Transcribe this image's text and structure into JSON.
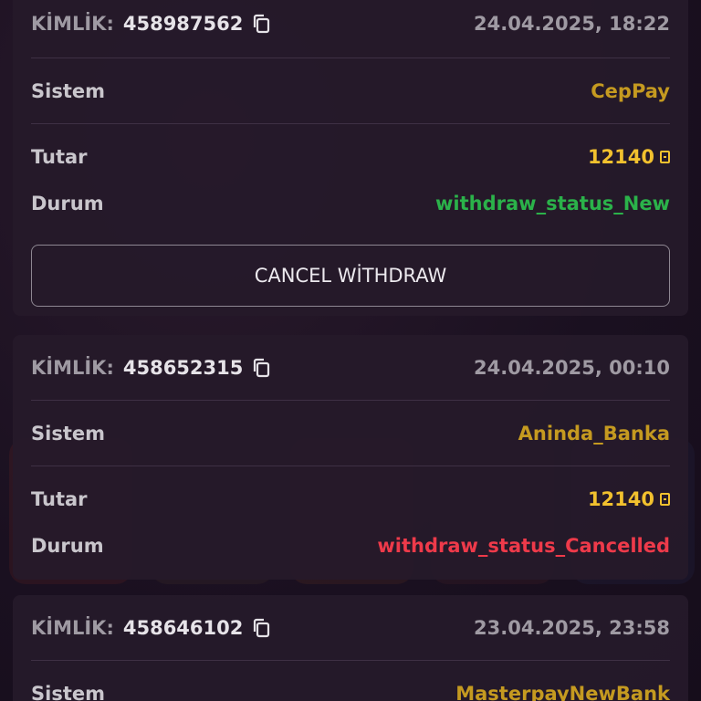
{
  "colors": {
    "background": "#1b1120",
    "card": "#261a2a",
    "system_value": "#c59a20",
    "amount_value": "#f2c12e",
    "status_new": "#2bb24a",
    "status_cancelled": "#ee3a4a"
  },
  "icons": {
    "copy": "copy-icon",
    "currency": "currency-icon"
  },
  "labels": {
    "id": "KİMLİK:",
    "system": "Sistem",
    "amount": "Tutar",
    "status": "Durum"
  },
  "transactions": [
    {
      "id": "458987562",
      "datetime": "24.04.2025, 18:22",
      "system": "CepPay",
      "amount": "12140",
      "status": "withdraw_status_New",
      "action_label": "CANCEL WİTHDRAW"
    },
    {
      "id": "458652315",
      "datetime": "24.04.2025, 00:10",
      "system": "Aninda_Banka",
      "amount": "12140",
      "status": "withdraw_status_Cancelled"
    },
    {
      "id": "458646102",
      "datetime": "23.04.2025, 23:58",
      "system": "MasterpayNewBank"
    }
  ]
}
